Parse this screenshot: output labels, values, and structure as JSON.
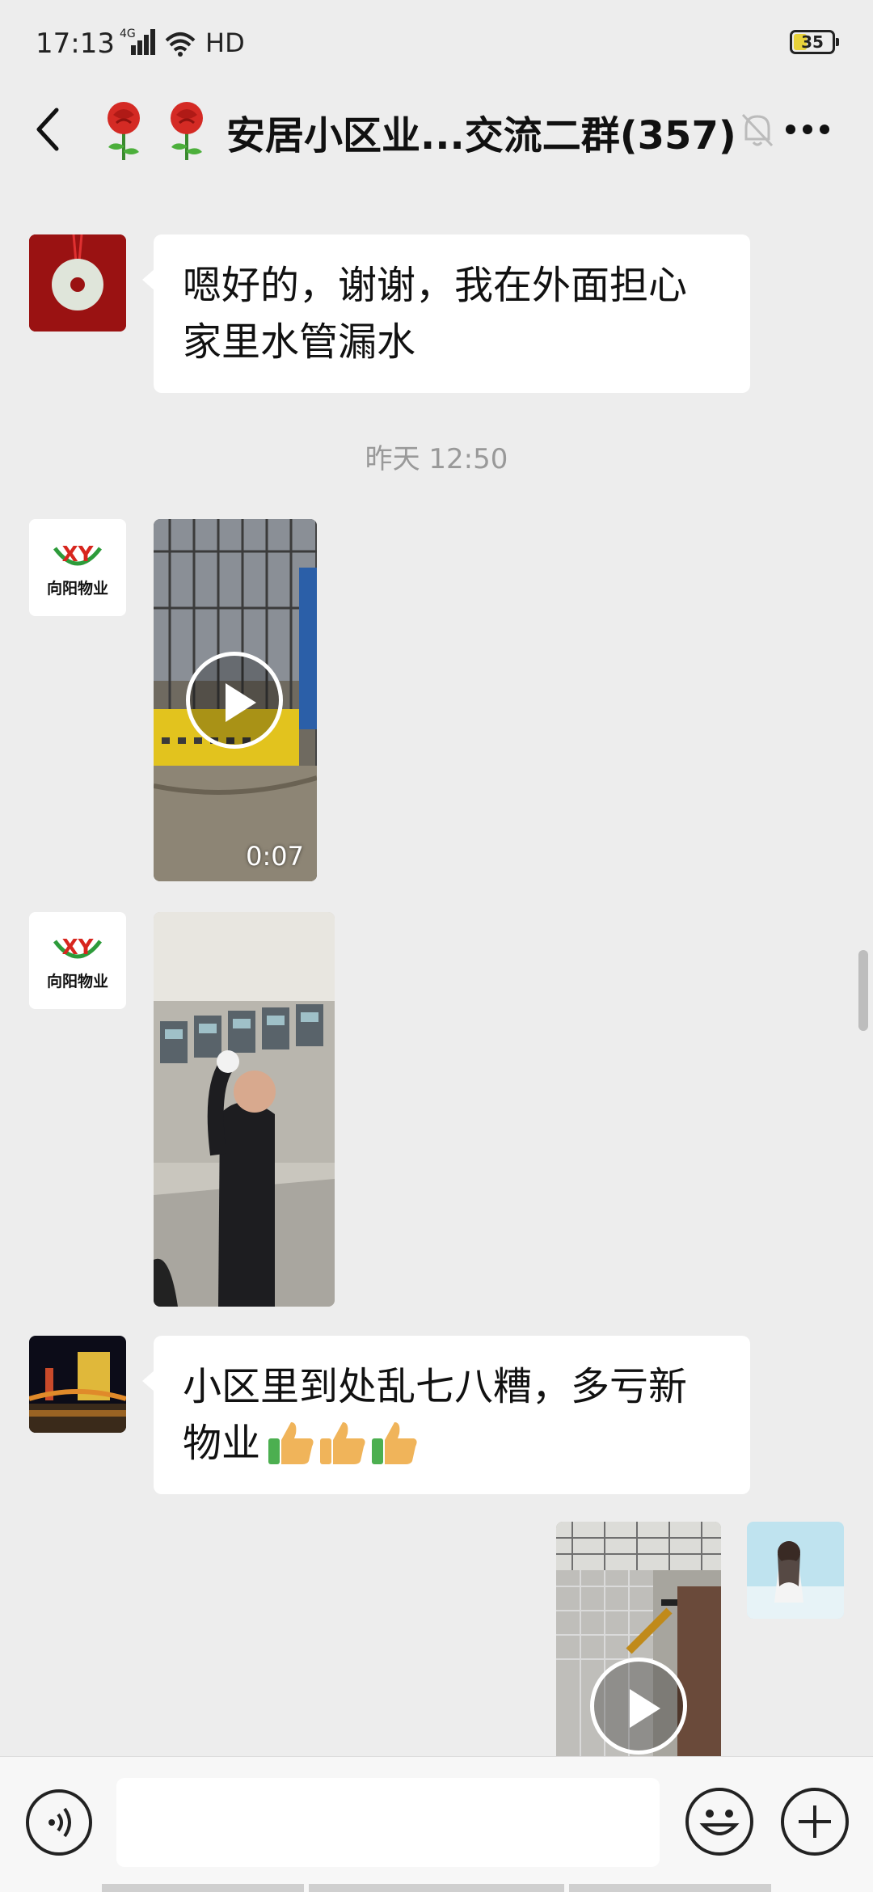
{
  "status_bar": {
    "time": "17:13",
    "network": "4G",
    "hd": "HD",
    "battery": "35",
    "battery_fraction": 0.35
  },
  "header": {
    "title": "安居小区业...交流二群(357)"
  },
  "messages": [
    {
      "text_line1": "嗯好的，谢谢，我在外面担心",
      "text_line2": "家里水管漏水"
    },
    {
      "timestamp": "昨天 12:50"
    },
    {
      "avatar_text": "向阳物业",
      "avatar_logo": "XY",
      "duration": "0:07"
    },
    {
      "avatar_text": "向阳物业",
      "avatar_logo": "XY"
    },
    {
      "text_line1": "小区里到处乱七八糟，多亏新",
      "text_line2": "物业"
    }
  ],
  "colors": {
    "background": "#ededed",
    "bubble": "#ffffff",
    "logo_green": "#2d9b3a",
    "logo_red": "#d7261e",
    "thumbs": "#f0b45a"
  },
  "icons": [
    "back-arrow-icon",
    "rose-icon",
    "mute-bell-icon",
    "more-dots-icon",
    "play-icon",
    "voice-icon",
    "emoji-icon",
    "plus-icon",
    "thumbs-up-icon"
  ]
}
